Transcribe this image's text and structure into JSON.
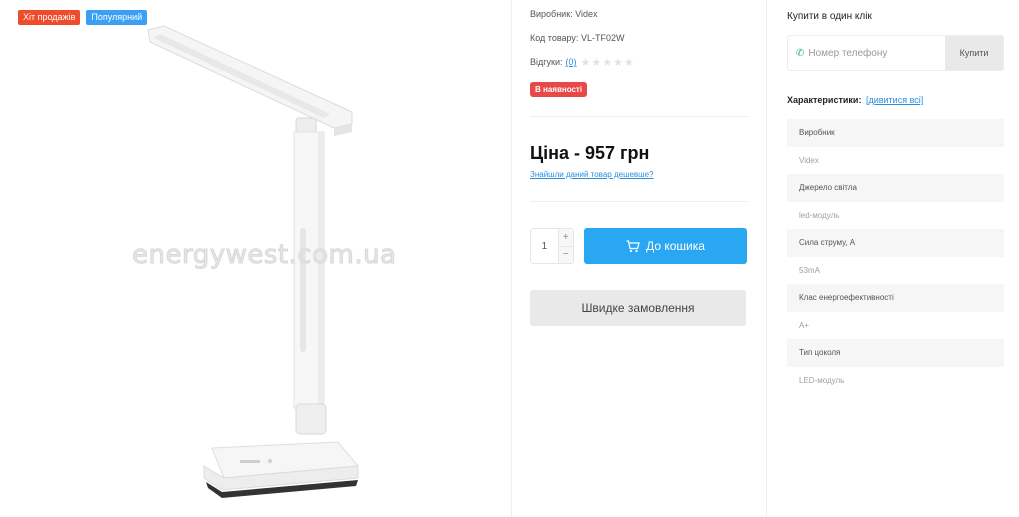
{
  "badges": {
    "hit": "Хіт продажів",
    "popular": "Популярний"
  },
  "watermark": "energywest.com.ua",
  "product": {
    "manufacturer_label": "Виробник:",
    "manufacturer": "Videx",
    "code_label": "Код товару:",
    "code": "VL-TF02W",
    "reviews_label": "Відгуки:",
    "reviews_count": "(0)",
    "stars": "★★★★★",
    "stock": "В наявності",
    "price": "Ціна - 957 грн",
    "cheaper_link": "Знайшли даний товар дешевше?",
    "quantity": "1",
    "qty_plus": "+",
    "qty_minus": "−",
    "cart_button": "До кошика",
    "quick_order_button": "Швидке замовлення"
  },
  "one_click": {
    "title": "Купити в один клік",
    "phone_placeholder": "Номер телефону",
    "phone_icon": "phone-icon",
    "buy_button": "Купити"
  },
  "characteristics": {
    "title": "Характеристики:",
    "view_all": "[дивитися всі]",
    "items": [
      {
        "name": "Виробник",
        "value": "Videx"
      },
      {
        "name": "Джерело світла",
        "value": "led-модуль"
      },
      {
        "name": "Сила струму, А",
        "value": "53mA"
      },
      {
        "name": "Клас енергоефективності",
        "value": "A+"
      },
      {
        "name": "Тип цоколя",
        "value": "LED-модуль"
      }
    ]
  },
  "colors": {
    "accent": "#2aa7f2",
    "hit_badge": "#ef4b2d",
    "popular_badge": "#3a9ff5",
    "stock_badge": "#e84848",
    "link": "#2a8fe0"
  }
}
